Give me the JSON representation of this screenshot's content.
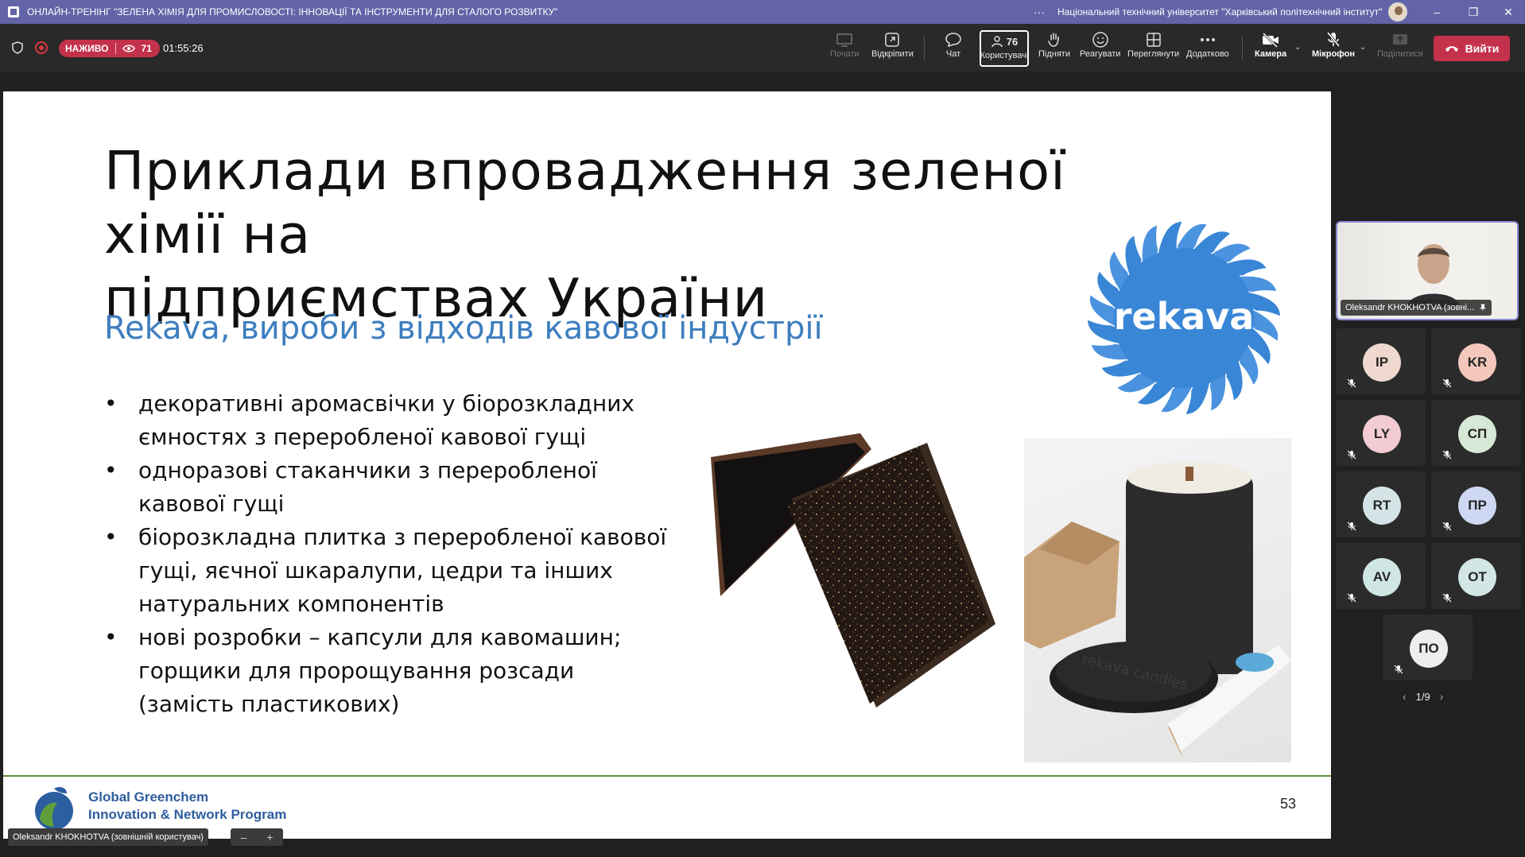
{
  "titlebar": {
    "title": "ОНЛАЙН-ТРЕНІНГ \"ЗЕЛЕНА ХІМІЯ ДЛЯ ПРОМИСЛОВОСТІ: ІННОВАЦІЇ ТА ІНСТРУМЕНТИ ДЛЯ СТАЛОГО РОЗВИТКУ\"",
    "more": "···",
    "organization": "Національний технічний університет \"Харківський політехнічний інститут\"",
    "minimize": "–",
    "restore": "❐",
    "close": "✕"
  },
  "toolbar": {
    "live_label": "НАЖИВО",
    "viewers": "71",
    "timer": "01:55:26",
    "start": "Почати",
    "unpin": "Відкріпити",
    "chat": "Чат",
    "participants_count": "76",
    "participants": "Користувачі",
    "raise": "Підняти",
    "react": "Реагувати",
    "view": "Переглянути",
    "more": "Додатково",
    "camera": "Камера",
    "mic": "Мікрофон",
    "share": "Поділитися",
    "leave": "Вийти"
  },
  "slide": {
    "title_line1": "Приклади впровадження зеленої хімії на",
    "title_line2": "підприємствах України",
    "subtitle": "Rekava, вироби з відходів кавової індустрії",
    "bullets": [
      "декоративні аромасвічки у біорозкладних ємностях з переробленої кавової гущі",
      "одноразові стаканчики з переробленої кавової гущі",
      "біорозкладна плитка з переробленої кавової гущі, яєчної шкаралупи, цедри та інших натуральних компонентів",
      "нові розробки – капсули для кавомашин; горщики для пророщування розсади (замість пластикових)"
    ],
    "brand": "rekava",
    "candle_lid_text": "rekava candles",
    "footer_org_line1": "Global Greenchem",
    "footer_org_line2": "Innovation & Network Program",
    "page_number": "53"
  },
  "presenter_strip": "Oleksandr KHOKHOTVA (зовнішній користувач)",
  "zoom": {
    "minus": "–",
    "plus": "+"
  },
  "participants": {
    "main_label": "Oleksandr KHOKHOTVA (зовні...",
    "tiles": [
      {
        "initials": "IP",
        "color": "#efd9cf"
      },
      {
        "initials": "KR",
        "color": "#f3c7bb"
      },
      {
        "initials": "LY",
        "color": "#f2cbd3"
      },
      {
        "initials": "СП",
        "color": "#d6e8d6"
      },
      {
        "initials": "RT",
        "color": "#d3e3e6"
      },
      {
        "initials": "ПР",
        "color": "#cfd8f2"
      },
      {
        "initials": "AV",
        "color": "#cfe6e4"
      },
      {
        "initials": "OT",
        "color": "#d2e6e6"
      },
      {
        "initials": "ПО",
        "color": "#eeeeee"
      }
    ],
    "page": "1/9",
    "prev": "‹",
    "next": "›"
  }
}
